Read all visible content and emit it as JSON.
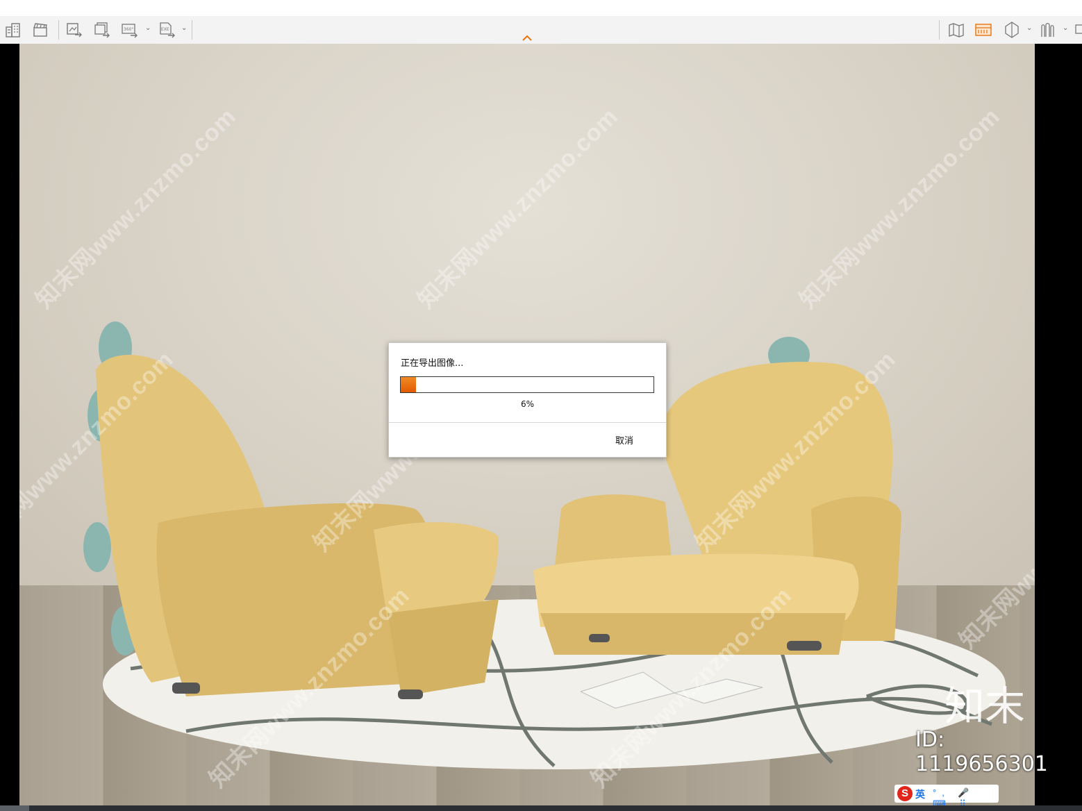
{
  "toolbar": {
    "left_icons": [
      "building-icon",
      "clapper-icon",
      "export-image-icon",
      "export-batch-icon",
      "export-360-icon",
      "export-exe-icon"
    ],
    "badge_360": "360°",
    "badge_exe": "EXE",
    "right_icons": [
      "map-icon",
      "ruler-panel-icon",
      "cube-icon",
      "people-icon",
      "window-icon"
    ]
  },
  "dialog": {
    "title": "正在导出图像...",
    "progress": 0.06,
    "percent_text": "6%",
    "cancel_label": "取消"
  },
  "watermark": {
    "text": "知末网www.znzmo.com",
    "logo_text": "知末",
    "id_text": "ID: 1119656301"
  },
  "ime": {
    "brand": "S",
    "lang": "英",
    "extras": "°, 🎤 ⌨ ⠿"
  },
  "colors": {
    "accent": "#e8720c",
    "toolbar_bg": "#f3f3f3"
  }
}
